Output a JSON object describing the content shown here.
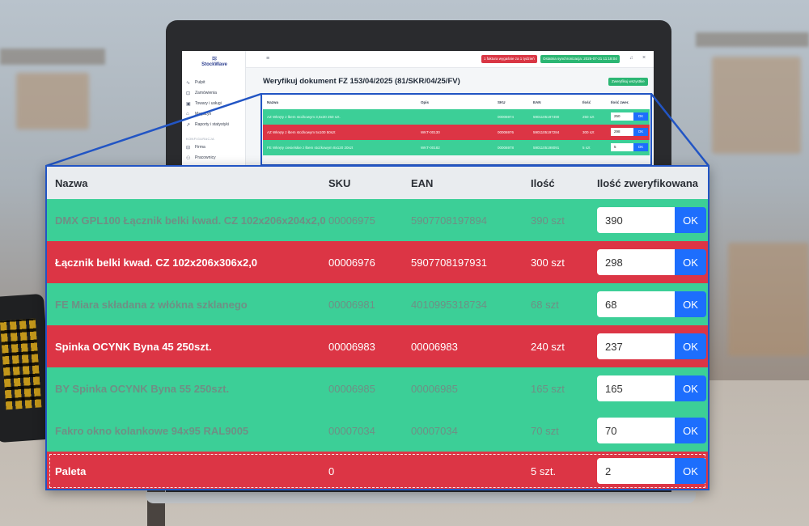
{
  "sidebar": {
    "brand": "StockWave",
    "items": [
      {
        "label": "Pulpit",
        "icon": "chart-icon"
      },
      {
        "label": "Zamówienia",
        "icon": "cart-icon"
      },
      {
        "label": "Towary i usługi",
        "icon": "box-icon"
      },
      {
        "label": "Magazyn",
        "icon": "warehouse-icon"
      },
      {
        "label": "Raporty i statystyki",
        "icon": "chart-line-icon"
      }
    ],
    "section_label": "KONFIGURACJA",
    "section_items": [
      {
        "label": "Firma",
        "icon": "building-icon"
      },
      {
        "label": "Pracownicy",
        "icon": "users-icon"
      }
    ]
  },
  "topbar": {
    "alert_badge": "1 faktura wygaśnie za 1 tydzień",
    "sync_badge": "Ostatnia synchronizacja: 2025-07-21 11:18:04"
  },
  "document": {
    "title": "Weryfikuj dokument FZ 153/04/2025 (81/SKR/04/25/FV)",
    "verify_all_label": "Zweryfikuj wszystkie"
  },
  "mini_table": {
    "headers": [
      "Nazwa",
      "Opis",
      "SKU",
      "EAN",
      "Ilość",
      "Ilość zwer."
    ],
    "rows": [
      {
        "name": "AZ Wkręty z łbem stożkowym 3,5x30 250 szt.",
        "desc": "",
        "sku": "00006974",
        "ean": "5901105197490",
        "qty": "250 szt",
        "value": "250",
        "status": "green"
      },
      {
        "name": "AZ Wkręty z łbem stożkowym 5x100 50szt",
        "desc": "WKT-00130",
        "sku": "00006976",
        "ean": "5901105197284",
        "qty": "300 szt",
        "value": "298",
        "status": "red"
      },
      {
        "name": "FE Wkręty ciesielskie z łbem stożkowym 8x120 20szt",
        "desc": "WKT-00182",
        "sku": "00006978",
        "ean": "5901105198091",
        "qty": "5 szt",
        "value": "5",
        "status": "green"
      }
    ],
    "ok_label": "OK"
  },
  "table": {
    "headers": {
      "name": "Nazwa",
      "sku": "SKU",
      "ean": "EAN",
      "qty": "Ilość",
      "verified": "Ilość zweryfikowana"
    },
    "ok_label": "OK",
    "rows": [
      {
        "name": "DMX GPL100 Łącznik belki kwad. CZ 102x206x204x2,0",
        "sku": "00006975",
        "ean": "5907708197894",
        "qty": "390 szt",
        "verified": "390",
        "status": "green"
      },
      {
        "name": "Łącznik belki kwad. CZ 102x206x306x2,0",
        "sku": "00006976",
        "ean": "5907708197931",
        "qty": "300 szt",
        "verified": "298",
        "status": "red"
      },
      {
        "name": "FE Miara składana z włókna szklanego",
        "sku": "00006981",
        "ean": "4010995318734",
        "qty": "68 szt",
        "verified": "68",
        "status": "green"
      },
      {
        "name": "Spinka OCYNK Byna 45 250szt.",
        "sku": "00006983",
        "ean": "00006983",
        "qty": "240 szt",
        "verified": "237",
        "status": "red"
      },
      {
        "name": "BY Spinka OCYNK Byna 55 250szt.",
        "sku": "00006985",
        "ean": "00006985",
        "qty": "165 szt",
        "verified": "165",
        "status": "green"
      },
      {
        "name": "Fakro okno kolankowe 94x95 RAL9005",
        "sku": "00007034",
        "ean": "00007034",
        "qty": "70 szt",
        "verified": "70",
        "status": "green"
      },
      {
        "name": "Paleta",
        "sku": "0",
        "ean": "",
        "qty": "5 szt.",
        "verified": "2",
        "status": "red",
        "pallet": true
      }
    ]
  },
  "colors": {
    "verified_ok": "#3ccf97",
    "verified_mismatch": "#dc3545",
    "ok_button": "#1d6efd",
    "zoom_frame": "#2255c4"
  }
}
